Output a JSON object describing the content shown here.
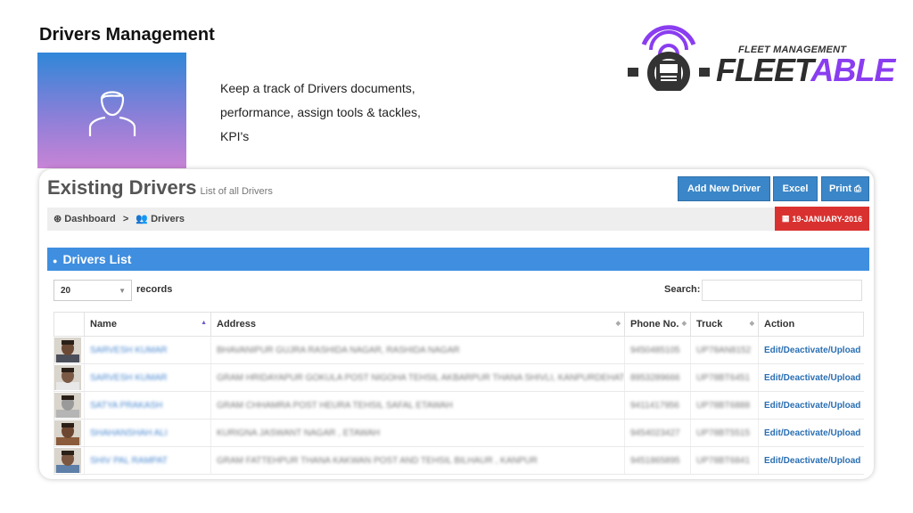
{
  "slide": {
    "title": "Drivers Management",
    "description": "Keep a track of Drivers documents, performance, assign tools & tackles, KPI's",
    "logo": {
      "sub": "FLEET MANAGEMENT",
      "main_dark": "FLEET",
      "main_accent": "ABLE",
      "accent_color": "#8a3df0"
    }
  },
  "app": {
    "page_title": "Existing Drivers",
    "page_subtitle": "List of all Drivers",
    "buttons": {
      "add": "Add New Driver",
      "excel": "Excel",
      "print": "Print"
    },
    "breadcrumb": {
      "home": "Dashboard",
      "sep": ">",
      "current": "Drivers"
    },
    "date": "19-JANUARY-2016",
    "panel_title": "Drivers List",
    "records_value": "20",
    "records_label": "records",
    "search_label": "Search:",
    "columns": [
      "Name",
      "Address",
      "Phone No.",
      "Truck",
      "Action"
    ],
    "rows": [
      {
        "name": "SARVESH KUMAR",
        "address": "BHAVANIPUR GUJRA RASHIDA NAGAR, RASHIDA NAGAR",
        "phone": "9450485105",
        "truck": "UP78AN8152",
        "action": "Edit/Deactivate/Upload",
        "skin": "#6b4a35",
        "shirt": "#4b4f5a"
      },
      {
        "name": "SARVESH KUMAR",
        "address": "GRAM HRIDAYAPUR GOKULA POST NIGOHA TEHSIL AKBARPUR THANA SHIVLI, KANPURDEHAT",
        "phone": "8953289666",
        "truck": "UP78BT6451",
        "action": "Edit/Deactivate/Upload",
        "skin": "#7a5a45",
        "shirt": "#e8e8e8"
      },
      {
        "name": "SATYA PRAKASH",
        "address": "GRAM CHHAMRA POST HEURA TEHSIL SAFAL ETAWAH",
        "phone": "9411417956",
        "truck": "UP78BT6888",
        "action": "Edit/Deactivate/Upload",
        "skin": "#9a9a9a",
        "shirt": "#b5b5b5"
      },
      {
        "name": "SHAHANSHAH ALI",
        "address": "KURIGNA JASWANT NAGAR , ETAWAH",
        "phone": "9454023427",
        "truck": "UP78BT5515",
        "action": "Edit/Deactivate/Upload",
        "skin": "#6d4631",
        "shirt": "#8a5c3c"
      },
      {
        "name": "SHIV PAL RAMPAT",
        "address": "GRAM FATTEHPUR THANA KAKWAN POST AND TEHSIL BILHAUR , KANPUR",
        "phone": "9451865895",
        "truck": "UP78BT6841",
        "action": "Edit/Deactivate/Upload",
        "skin": "#7b5641",
        "shirt": "#5e7fa8"
      }
    ]
  }
}
